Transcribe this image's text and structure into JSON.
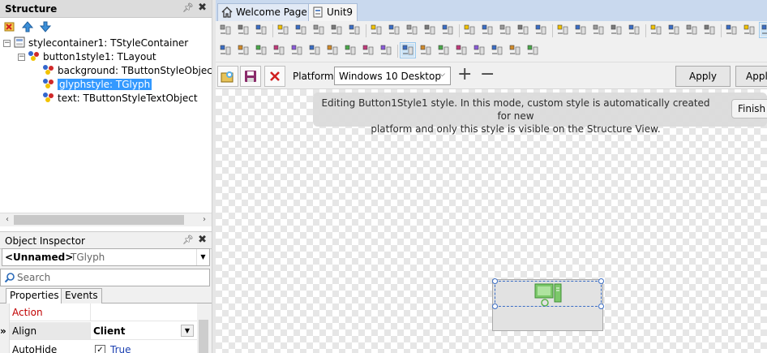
{
  "structure_panel": {
    "title": "Structure",
    "tree": [
      {
        "label": "stylecontainer1: TStyleContainer"
      },
      {
        "label": "button1style1: TLayout"
      },
      {
        "label": "background: TButtonStyleObject"
      },
      {
        "label": "glyphstyle: TGlyph"
      },
      {
        "label": "text: TButtonStyleTextObject"
      }
    ]
  },
  "object_inspector": {
    "title": "Object Inspector",
    "selected_name": "<Unnamed>",
    "selected_type": "TGlyph",
    "search_placeholder": "Search",
    "tabs": [
      "Properties",
      "Events"
    ],
    "properties": [
      {
        "name": "Action",
        "value": ""
      },
      {
        "name": "Align",
        "value": "Client"
      },
      {
        "name": "AutoHide",
        "value": "True"
      }
    ]
  },
  "editor_tabs": [
    "Welcome Page",
    "Unit9"
  ],
  "designer_bar": {
    "platform_label": "Platform:",
    "platform_value": "Windows 10 Desktop",
    "apply_label": "Apply",
    "apply_and_close_label": "Apply"
  },
  "notice": {
    "line1": "Editing Button1Style1 style. In this mode, custom style is automatically created for new",
    "line2": "platform and only this style is visible on the Structure View.",
    "finish_label": "Finish"
  },
  "colors": {
    "selection": "#3399ff",
    "property_name": "#c00000",
    "tab_strip": "#c9d9ee",
    "glyph_green": "#5bb54a"
  }
}
